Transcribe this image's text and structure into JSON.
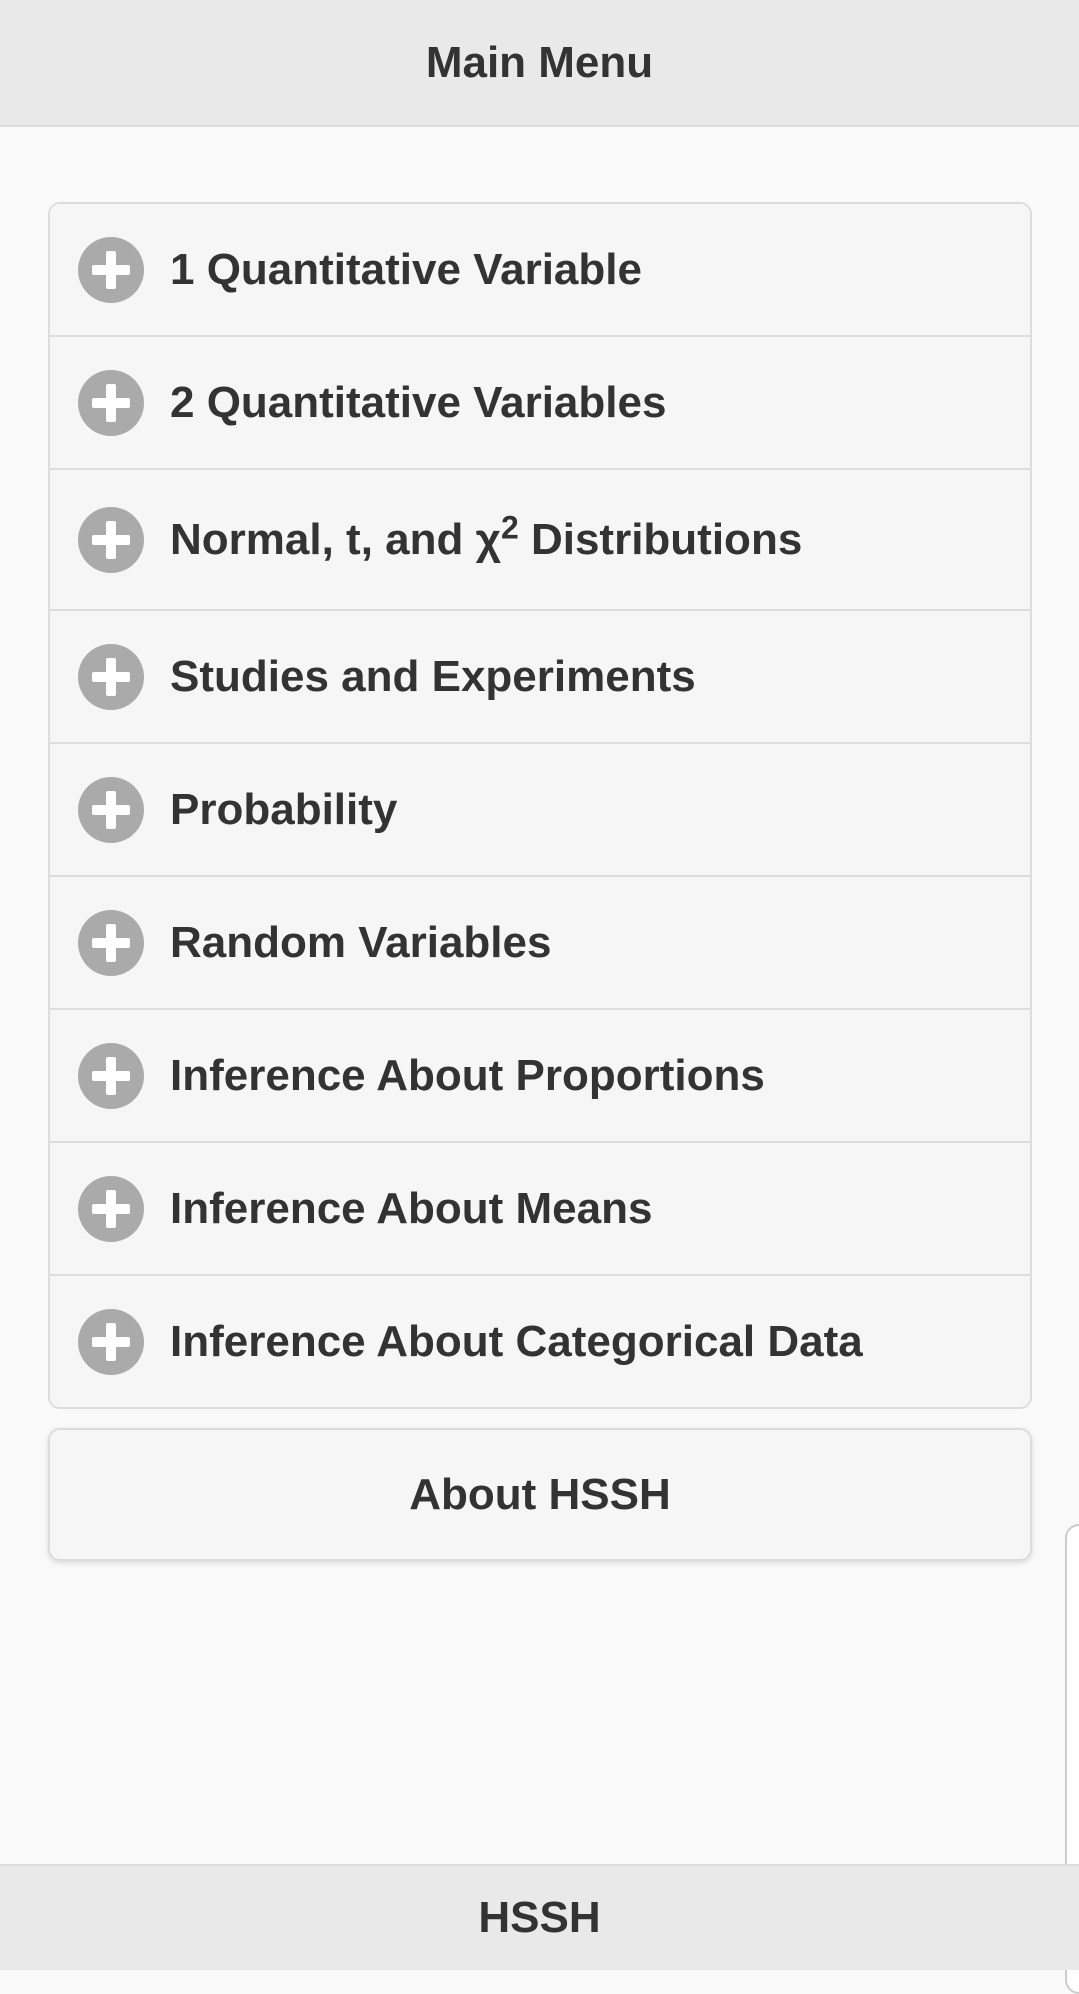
{
  "header": {
    "title": "Main Menu"
  },
  "menu": {
    "items": [
      {
        "label": "1 Quantitative Variable",
        "icon": "plus-circle-icon"
      },
      {
        "label": "2 Quantitative Variables",
        "icon": "plus-circle-icon"
      },
      {
        "label_prefix": "Normal, t, and χ",
        "label_sup": "2",
        "label_suffix": " Distributions",
        "icon": "plus-circle-icon"
      },
      {
        "label": "Studies and Experiments",
        "icon": "plus-circle-icon"
      },
      {
        "label": "Probability",
        "icon": "plus-circle-icon"
      },
      {
        "label": "Random Variables",
        "icon": "plus-circle-icon"
      },
      {
        "label": "Inference About Proportions",
        "icon": "plus-circle-icon"
      },
      {
        "label": "Inference About Means",
        "icon": "plus-circle-icon"
      },
      {
        "label": "Inference About Categorical Data",
        "icon": "plus-circle-icon"
      }
    ]
  },
  "about": {
    "label": "About HSSH"
  },
  "footer": {
    "title": "HSSH"
  },
  "colors": {
    "bar_background": "#e9e9e9",
    "page_background": "#f9f9f9",
    "item_background": "#f6f6f6",
    "border": "#dddddd",
    "icon": "#aaaaaa",
    "text": "#333333"
  }
}
